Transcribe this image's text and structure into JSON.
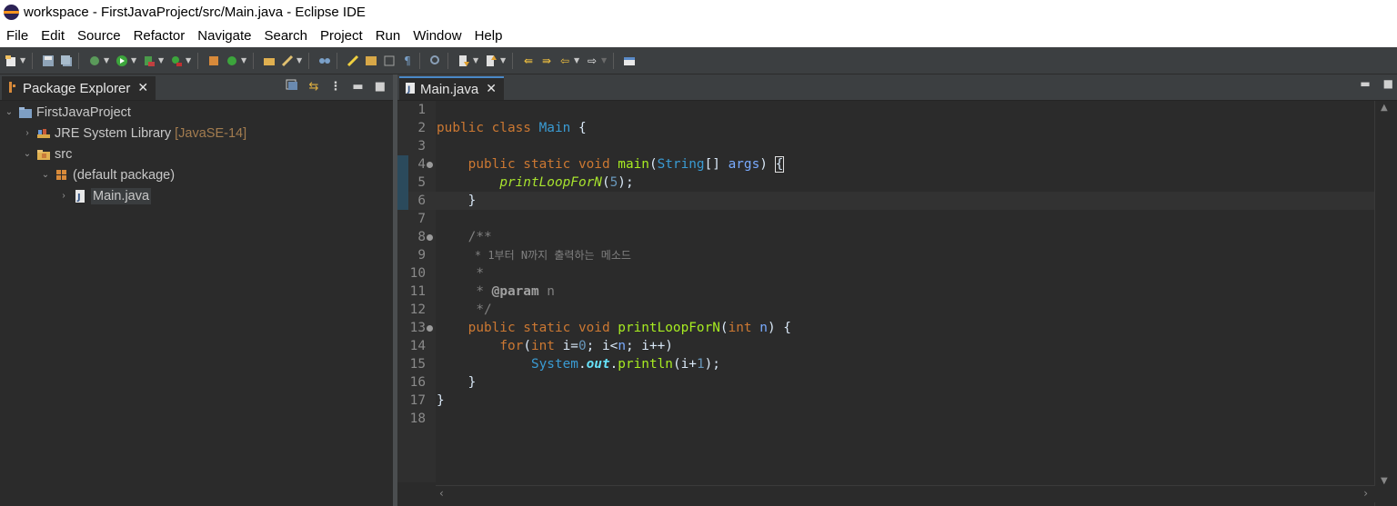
{
  "window": {
    "title": "workspace - FirstJavaProject/src/Main.java - Eclipse IDE"
  },
  "menu": [
    "File",
    "Edit",
    "Source",
    "Refactor",
    "Navigate",
    "Search",
    "Project",
    "Run",
    "Window",
    "Help"
  ],
  "package_explorer": {
    "tab_label": "Package Explorer",
    "tree": [
      {
        "label": "FirstJavaProject",
        "icon": "project-folder-icon",
        "extra": ""
      },
      {
        "label": "JRE System Library",
        "icon": "library-icon",
        "extra": "[JavaSE-14]"
      },
      {
        "label": "src",
        "icon": "source-folder-icon",
        "extra": ""
      },
      {
        "label": "(default package)",
        "icon": "package-icon",
        "extra": ""
      },
      {
        "label": "Main.java",
        "icon": "java-file-icon",
        "extra": ""
      }
    ]
  },
  "editor": {
    "tab_label": "Main.java",
    "line_numbers": [
      "1",
      "2",
      "3",
      "4",
      "5",
      "6",
      "7",
      "8",
      "9",
      "10",
      "11",
      "12",
      "13",
      "14",
      "15",
      "16",
      "17",
      "18"
    ],
    "code": {
      "l2_kw": "public class",
      "l2_cls": "Main",
      "l2_rest": " {",
      "l4_kw": "public static void",
      "l4_fn": "main",
      "l4_type": "String",
      "l4_mid": "[] ",
      "l4_var": "args",
      "l4_end": ") ",
      "l4_brace": "{",
      "l5_call": "printLoopForN",
      "l5_open": "(",
      "l5_num": "5",
      "l5_close": ");",
      "l6": "}",
      "l8": "/**",
      "l9": " * 1부터 N까지 출력하는 메소드",
      "l10": " *",
      "l11_pre": " * ",
      "l11_tag": "@param",
      "l11_post": " n",
      "l12": " */",
      "l13_kw": "public static void",
      "l13_fn": "printLoopForN",
      "l13_open": "(",
      "l13_type": "int",
      "l13_var": "n",
      "l13_close": ") {",
      "l14_kw": "for",
      "l14_a": "(",
      "l14_int": "int",
      "l14_b": " i=",
      "l14_zero": "0",
      "l14_c": "; i<",
      "l14_n": "n",
      "l14_d": "; i++)",
      "l15_sys": "System",
      "l15_dot": ".",
      "l15_out": "out",
      "l15_dot2": ".",
      "l15_m": "println",
      "l15_a": "(i+",
      "l15_one": "1",
      "l15_b": ");",
      "l16": "}",
      "l17": "}"
    }
  }
}
